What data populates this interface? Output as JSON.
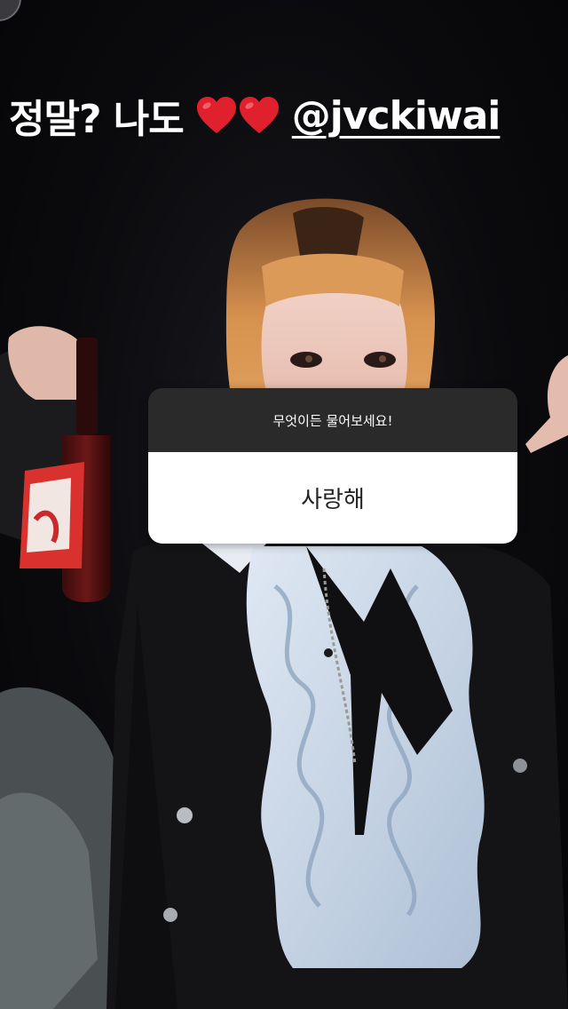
{
  "story": {
    "caption": {
      "text_before": "정말? 나도",
      "hearts": [
        "heart-emoji",
        "heart-emoji"
      ],
      "mention": "@jvckiwai"
    },
    "question_sticker": {
      "prompt": "무엇이든 물어보세요!",
      "answer": "사랑해"
    }
  },
  "colors": {
    "heart": "#e0202c",
    "card_header": "#2a2a2b",
    "card_body": "#ffffff",
    "caption_text": "#ffffff"
  }
}
